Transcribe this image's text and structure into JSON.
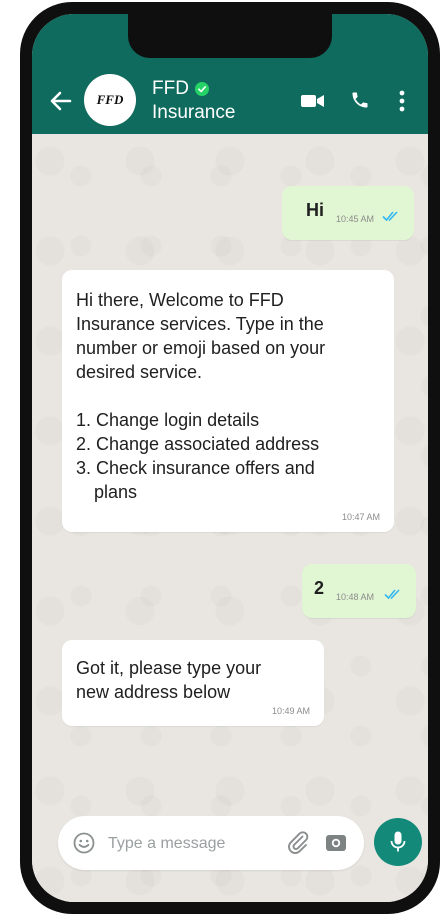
{
  "header": {
    "avatar_text": "FFD",
    "title": "FFD",
    "subtitle": "Insurance",
    "verified_color": "#25d366"
  },
  "messages": [
    {
      "direction": "outgoing",
      "text": "Hi",
      "time": "10:45 AM",
      "status": "read"
    },
    {
      "direction": "incoming",
      "lines": [
        "Hi there, Welcome to FFD",
        "Insurance services. Type in the",
        "number or emoji based on your",
        "desired service.",
        "",
        "1. Change login details",
        "2. Change associated address",
        "3. Check insurance offers and",
        "plans"
      ],
      "time": "10:47 AM"
    },
    {
      "direction": "outgoing",
      "text": "2",
      "time": "10:48 AM",
      "status": "read"
    },
    {
      "direction": "incoming",
      "lines": [
        "Got it, please type your",
        "new address below"
      ],
      "time": "10:49 AM"
    }
  ],
  "composer": {
    "placeholder": "Type a message",
    "value": ""
  },
  "colors": {
    "header": "#0e6b5d",
    "outgoing_bubble": "#e1f6d3",
    "incoming_bubble": "#ffffff",
    "mic_button": "#13897a",
    "read_ticks": "#34b7f1"
  },
  "icons": {
    "back": "arrow-left-icon",
    "video": "video-camera-icon",
    "call": "phone-icon",
    "menu": "more-vertical-icon",
    "emoji": "smiley-icon",
    "attach": "paperclip-icon",
    "camera": "camera-icon",
    "mic": "microphone-icon"
  }
}
